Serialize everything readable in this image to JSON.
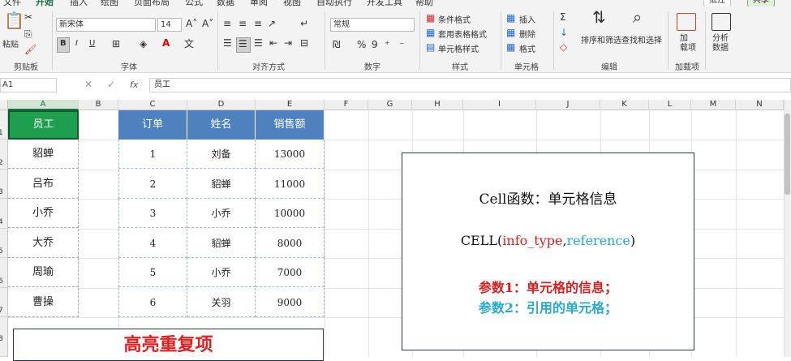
{
  "ribbon_tabs": [
    "文件",
    "开始",
    "插入",
    "绘图",
    "页面布局",
    "公式",
    "数据",
    "审阅",
    "视图",
    "自动执行",
    "开发工具",
    "帮助"
  ],
  "ribbon_buttons": {
    "comment": "批注",
    "share": "共享"
  },
  "clipboard": {
    "paste": "粘贴",
    "group": "剪贴板"
  },
  "font": {
    "name": "新宋体",
    "size": "14",
    "bold": "B",
    "italic": "I",
    "underline": "U",
    "group": "字体"
  },
  "alignment": {
    "group": "对齐方式"
  },
  "number": {
    "format": "常规",
    "group": "数字"
  },
  "styles": {
    "conditional": "条件格式",
    "table": "套用表格格式",
    "cell": "单元格样式",
    "group": "样式"
  },
  "cells": {
    "insert": "插入",
    "delete": "删除",
    "format": "格式",
    "group": "单元格"
  },
  "editing": {
    "sort": "排序和筛选",
    "find": "查找和选择",
    "group": "编辑"
  },
  "addins": {
    "label": "加\n载项",
    "group": "加载项"
  },
  "analyze": {
    "label": "分析\n数据"
  },
  "formula_bar": {
    "namebox": "A1",
    "fx": "fx",
    "content": "员工"
  },
  "columns": [
    "A",
    "B",
    "C",
    "D",
    "E",
    "F",
    "G",
    "H",
    "I",
    "J",
    "K",
    "L",
    "M",
    "N"
  ],
  "rows": [
    "1",
    "2",
    "3",
    "4",
    "5",
    "6",
    "7",
    "8"
  ],
  "col_a": [
    "员工",
    "貂蝉",
    "吕布",
    "小乔",
    "大乔",
    "周瑜",
    "曹操"
  ],
  "table": {
    "headers": [
      "订单",
      "姓名",
      "销售额"
    ],
    "rows": [
      [
        "1",
        "刘备",
        "13000"
      ],
      [
        "2",
        "貂蝉",
        "11000"
      ],
      [
        "3",
        "小乔",
        "10000"
      ],
      [
        "4",
        "貂蝉",
        "8000"
      ],
      [
        "5",
        "小乔",
        "7000"
      ],
      [
        "6",
        "关羽",
        "9000"
      ]
    ]
  },
  "info_box": {
    "title": "Cell函数：单元格信息",
    "formula_prefix": "CELL(",
    "formula_arg1": "info_type",
    "formula_comma": ",",
    "formula_arg2": "reference",
    "formula_suffix": ")",
    "param1": "参数1：单元格的信息；",
    "param2": "参数2：引用的单元格；"
  },
  "highlight_box": {
    "title": "高亮重复项"
  },
  "colors": {
    "accent_green": "#1e7145",
    "header_blue": "#4e81bd",
    "red": "#e02020",
    "cyan": "#29a9c9"
  }
}
